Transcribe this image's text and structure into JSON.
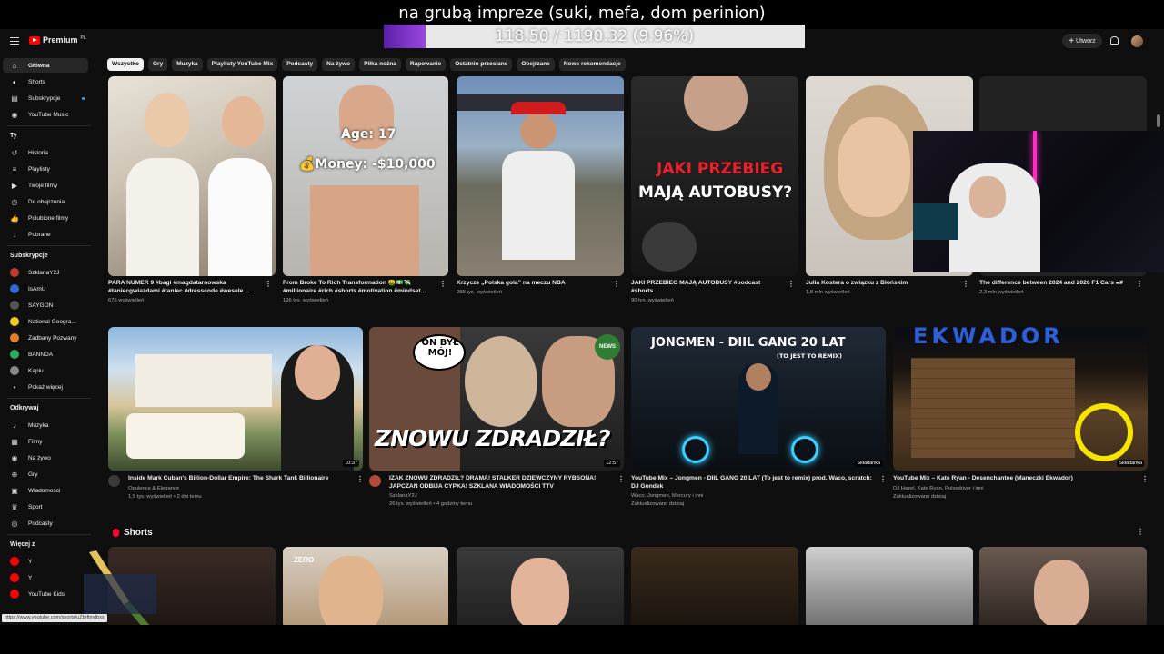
{
  "overlay": {
    "title": "na grubą impreze (suki, mefa, dom perinion)",
    "progress_text": "118.50 / 1190.32 (9.96%)",
    "progress_fraction": 0.0996
  },
  "header": {
    "logo_text": "Premium",
    "logo_sup": "PL",
    "create_label": "Utwórz"
  },
  "chips": [
    "Wszystko",
    "Gry",
    "Muzyka",
    "Playlisty YouTube Mix",
    "Podcasty",
    "Na żywo",
    "Piłka nożna",
    "Rapowanie",
    "Ostatnio przesłane",
    "Obejrzane",
    "Nowe rekomendacje"
  ],
  "sidebar": {
    "main": [
      {
        "label": "Główna",
        "icon": "home-icon"
      },
      {
        "label": "Shorts",
        "icon": "shorts-icon"
      },
      {
        "label": "Subskrypcje",
        "icon": "subscriptions-icon"
      },
      {
        "label": "YouTube Music",
        "icon": "music-icon"
      }
    ],
    "you_header": "Ty",
    "you": [
      {
        "label": "Historia",
        "icon": "history-icon"
      },
      {
        "label": "Playlisty",
        "icon": "playlist-icon"
      },
      {
        "label": "Twoje filmy",
        "icon": "video-icon"
      },
      {
        "label": "Do obejrzenia",
        "icon": "clock-icon"
      },
      {
        "label": "Polubione filmy",
        "icon": "like-icon"
      },
      {
        "label": "Pobrane",
        "icon": "download-icon"
      }
    ],
    "subs_header": "Subskrypcje",
    "subs": [
      {
        "label": "SzklanaY2J",
        "color": "#c0392b"
      },
      {
        "label": "IsAmU",
        "color": "#2f6ad8"
      },
      {
        "label": "SAYGON",
        "color": "#555"
      },
      {
        "label": "National Geogra...",
        "color": "#f5c518"
      },
      {
        "label": "Zadbany Pozwany",
        "color": "#e67e22"
      },
      {
        "label": "BANNDA",
        "color": "#27ae60"
      },
      {
        "label": "Kapiu",
        "color": "#888"
      }
    ],
    "show_more": "Pokaż więcej",
    "explore_header": "Odkrywaj",
    "explore": [
      {
        "label": "Muzyka",
        "icon": "music-note-icon"
      },
      {
        "label": "Filmy",
        "icon": "film-icon"
      },
      {
        "label": "Na żywo",
        "icon": "live-icon"
      },
      {
        "label": "Gry",
        "icon": "gamepad-icon"
      },
      {
        "label": "Wiadomości",
        "icon": "news-icon"
      },
      {
        "label": "Sport",
        "icon": "trophy-icon"
      },
      {
        "label": "Podcasty",
        "icon": "podcast-icon"
      }
    ],
    "more_header": "Więcej z",
    "more": [
      {
        "label": "Y",
        "color": "#ff0000"
      },
      {
        "label": "Y",
        "color": "#ff0000"
      },
      {
        "label": "YouTube Kids",
        "color": "#ff0000"
      }
    ]
  },
  "row1": [
    {
      "title": "PARA NUMER 9 #bagi #magdatarnowska #taniecgwiazdami #taniec #dresscode #wesele ...",
      "meta": "676 wyświetleń"
    },
    {
      "title": "From Broke To Rich Transformation 🤑💵💸 #millionaire #rich #shorts #motivation #mindset...",
      "meta": "196 tys. wyświetleń",
      "overlay1": "Age: 17",
      "overlay2": "💰Money: -$10,000"
    },
    {
      "title": "Krzycze „Polska gola” na meczu NBA",
      "meta": "288 tys. wyświetleń"
    },
    {
      "title": "JAKI PRZEBIEG MAJĄ AUTOBUSY #podcast #shorts",
      "meta": "90 tys. wyświetleń",
      "overlay1": "JAKI PRZEBIEG",
      "overlay2": "MAJĄ AUTOBUSY?"
    },
    {
      "title": "Julia Kostera o związku z Błońskim",
      "meta": "1,8 mln wyświetleń"
    },
    {
      "title": "The difference between 2024 and 2026 F1 Cars 🏎",
      "meta": "2,3 mln wyświetleń"
    }
  ],
  "row2": [
    {
      "title": "Inside Mark Cuban's Billion-Dollar Empire: The Shark Tank Billionaire",
      "channel": "Opulence & Elegance",
      "meta": "1,5 tys. wyświetleń • 2 dni temu",
      "duration": "10:37"
    },
    {
      "title": "IZAK ZNOWU ZDRADZIŁ? DRAMA! STALKER DZIEWCZYNY RYBSONA! JAPCZAN ODBIJA CYPKA! SZKLANA WIADOMOŚCI TTV",
      "channel": "SzklanaY2J",
      "meta": "26 tys. wyświetleń • 4 godziny temu",
      "duration": "12:57",
      "overlay1": "ON BYŁ MÓJ!",
      "overlay2": "ZNOWU ZDRADZIŁ?",
      "badge": "NEWS"
    },
    {
      "title": "YouTube Mix – Jongmen - DIIL GANG 20 LAT (To jest to remix) prod. Waco, scratch: DJ Gondek",
      "channel": "Waco, Jongmen, Mercury i inni",
      "meta": "Zaktualizowano dzisiaj",
      "duration": "Składanka",
      "overlay1": "JONGMEN - DIIL GANG 20 LAT",
      "overlay2": "(TO JEST TO REMIX)"
    },
    {
      "title": "YouTube Mix – Kate Ryan - Desenchantee (Maneczki Ekwador)",
      "channel": "DJ Hazel, Kate Ryan, Pulsedriver i inni",
      "meta": "Zaktualizowano dzisiaj",
      "duration": "Składanka",
      "overlay1": "EKWADOR"
    }
  ],
  "shorts_label": "Shorts",
  "url_tooltip": "https://www.youtube.com/shorts/uZbrftmdbxs"
}
